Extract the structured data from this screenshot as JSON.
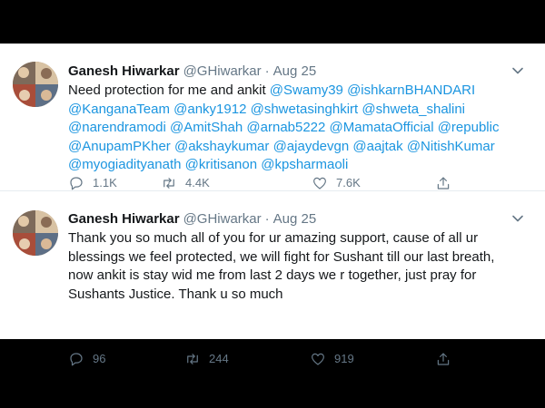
{
  "tweets": [
    {
      "name": "Ganesh Hiwarkar",
      "handle": "@GHiwarkar",
      "separator": "·",
      "date": "Aug 25",
      "text_intro": "Need protection for me and ankit ",
      "mentions": [
        "@Swamy39",
        "@ishkarnBHANDARI",
        "@KanganaTeam",
        "@anky1912",
        "@shwetasinghkirt",
        "@shweta_shalini",
        "@narendramodi",
        "@AmitShah",
        "@arnab5222",
        "@MamataOfficial",
        "@republic",
        "@AnupamPKher",
        "@akshaykumar",
        "@ajaydevgn",
        "@aajtak",
        "@NitishKumar",
        "@myogiadityanath",
        "@kritisanon",
        "@kpsharmaoli"
      ],
      "replies": "1.1K",
      "retweets": "4.4K",
      "likes": "7.6K"
    },
    {
      "name": "Ganesh Hiwarkar",
      "handle": "@GHiwarkar",
      "separator": "·",
      "date": "Aug 25",
      "text": "Thank you so much all of you for ur amazing support, cause of all ur blessings we feel protected, we will fight for Sushant till our last breath, now ankit is stay wid me from last 2 days we r together, just pray for Sushants Justice. Thank u so much",
      "replies": "96",
      "retweets": "244",
      "likes": "919"
    }
  ],
  "icons": {
    "reply": "reply-icon",
    "retweet": "retweet-icon",
    "like": "heart-icon",
    "share": "share-icon",
    "more": "chevron-down-icon"
  },
  "colors": {
    "mention": "#1b95e0",
    "secondary_text": "#657786",
    "primary_text": "#14171a",
    "background": "#ffffff",
    "letterbox": "#000000"
  }
}
